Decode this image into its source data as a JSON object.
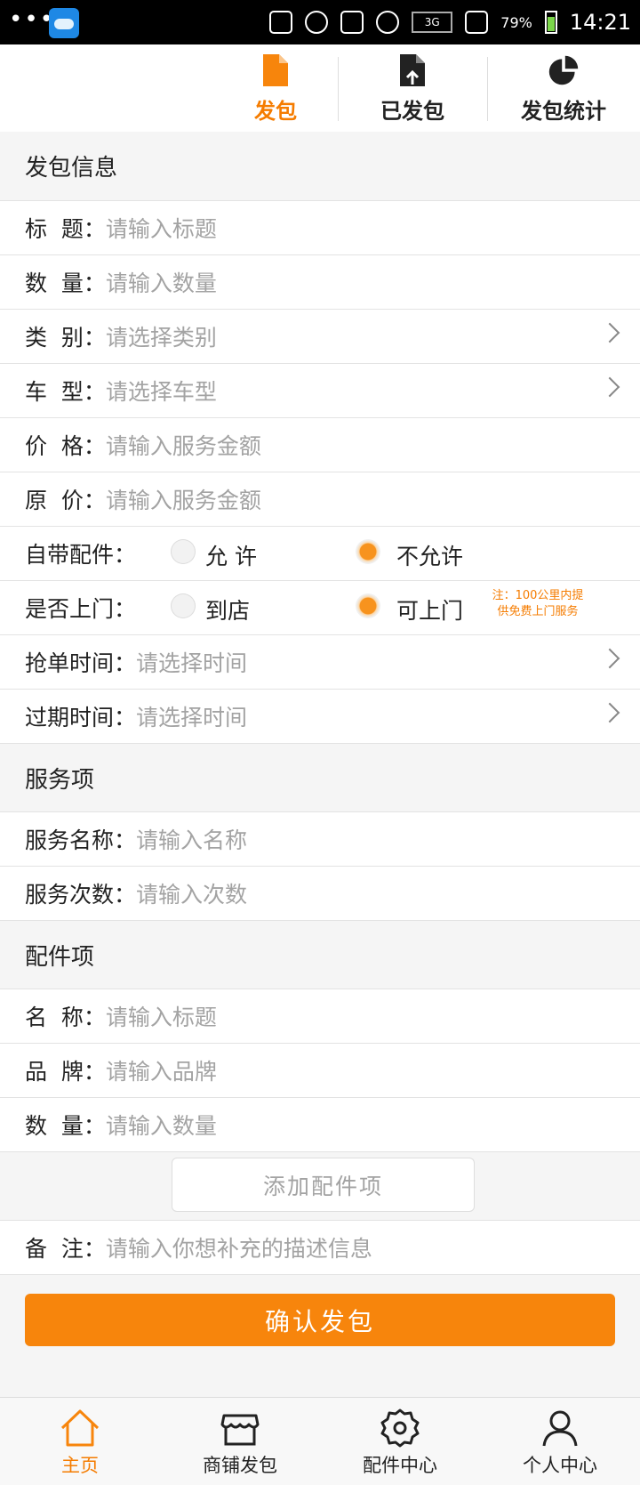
{
  "status_bar": {
    "battery": "79%",
    "time": "14:21",
    "network": "3G"
  },
  "top_tabs": [
    {
      "label": "发包",
      "icon": "document-icon",
      "active": true
    },
    {
      "label": "已发包",
      "icon": "document-upload-icon",
      "active": false
    },
    {
      "label": "发包统计",
      "icon": "pie-chart-icon",
      "active": false
    }
  ],
  "package_info": {
    "title": "发包信息",
    "title_field": {
      "label": "标  题：",
      "placeholder": "请输入标题"
    },
    "quantity_field": {
      "label": "数  量：",
      "placeholder": "请输入数量"
    },
    "category_field": {
      "label": "类  别：",
      "placeholder": "请选择类别"
    },
    "car_model_field": {
      "label": "车  型：",
      "placeholder": "请选择车型"
    },
    "price_field": {
      "label": "价  格：",
      "placeholder": "请输入服务金额"
    },
    "original_price_field": {
      "label": "原  价：",
      "placeholder": "请输入服务金额"
    },
    "own_parts": {
      "label": "自带配件：",
      "option_allow": "允 许",
      "option_disallow": "不允许",
      "selected": "不允许"
    },
    "home_service": {
      "label": "是否上门：",
      "option_store": "到店",
      "option_home": "可上门",
      "selected": "可上门",
      "note_line1": "注：100公里内提",
      "note_line2": "供免费上门服务"
    },
    "grab_time_field": {
      "label": "抢单时间：",
      "placeholder": "请选择时间"
    },
    "expire_time_field": {
      "label": "过期时间：",
      "placeholder": "请选择时间"
    }
  },
  "service_item": {
    "title": "服务项",
    "name_field": {
      "label": "服务名称：",
      "placeholder": "请输入名称"
    },
    "count_field": {
      "label": "服务次数：",
      "placeholder": "请输入次数"
    }
  },
  "parts_item": {
    "title": "配件项",
    "name_field": {
      "label": "名  称：",
      "placeholder": "请输入标题"
    },
    "brand_field": {
      "label": "品  牌：",
      "placeholder": "请输入品牌"
    },
    "quantity_field": {
      "label": "数  量：",
      "placeholder": "请输入数量"
    },
    "add_button": "添加配件项"
  },
  "remarks_field": {
    "label": "备  注：",
    "placeholder": "请输入你想补充的描述信息"
  },
  "confirm_button": "确认发包",
  "bottom_nav": [
    {
      "label": "主页",
      "icon": "home-icon",
      "active": true
    },
    {
      "label": "商铺发包",
      "icon": "shop-icon",
      "active": false
    },
    {
      "label": "配件中心",
      "icon": "gear-icon",
      "active": false
    },
    {
      "label": "个人中心",
      "icon": "user-icon",
      "active": false
    }
  ],
  "colors": {
    "accent": "#f7850c",
    "text": "#222222",
    "placeholder": "#a3a3a3"
  }
}
